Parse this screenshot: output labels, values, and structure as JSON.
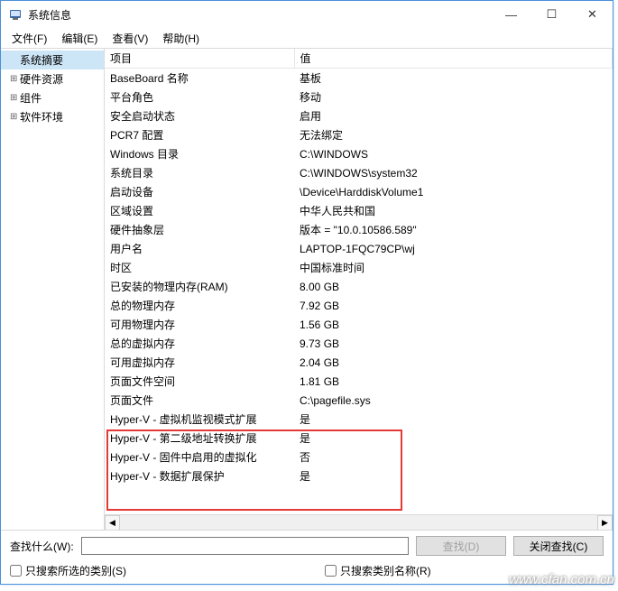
{
  "window": {
    "title": "系统信息"
  },
  "menubar": [
    {
      "label": "文件(F)"
    },
    {
      "label": "编辑(E)"
    },
    {
      "label": "查看(V)"
    },
    {
      "label": "帮助(H)"
    }
  ],
  "tree": [
    {
      "label": "系统摘要",
      "selected": true,
      "expand": ""
    },
    {
      "label": "硬件资源",
      "expand": "⊞"
    },
    {
      "label": "组件",
      "expand": "⊞"
    },
    {
      "label": "软件环境",
      "expand": "⊞"
    }
  ],
  "grid": {
    "headers": [
      "项目",
      "值"
    ],
    "rows": [
      [
        "BaseBoard 名称",
        "基板"
      ],
      [
        "平台角色",
        "移动"
      ],
      [
        "安全启动状态",
        "启用"
      ],
      [
        "PCR7 配置",
        "无法绑定"
      ],
      [
        "Windows 目录",
        "C:\\WINDOWS"
      ],
      [
        "系统目录",
        "C:\\WINDOWS\\system32"
      ],
      [
        "启动设备",
        "\\Device\\HarddiskVolume1"
      ],
      [
        "区域设置",
        "中华人民共和国"
      ],
      [
        "硬件抽象层",
        "版本 = \"10.0.10586.589\""
      ],
      [
        "用户名",
        "LAPTOP-1FQC79CP\\wj"
      ],
      [
        "时区",
        "中国标准时间"
      ],
      [
        "已安装的物理内存(RAM)",
        "8.00 GB"
      ],
      [
        "总的物理内存",
        "7.92 GB"
      ],
      [
        "可用物理内存",
        "1.56 GB"
      ],
      [
        "总的虚拟内存",
        "9.73 GB"
      ],
      [
        "可用虚拟内存",
        "2.04 GB"
      ],
      [
        "页面文件空间",
        "1.81 GB"
      ],
      [
        "页面文件",
        "C:\\pagefile.sys"
      ],
      [
        "Hyper-V - 虚拟机监视模式扩展",
        "是"
      ],
      [
        "Hyper-V - 第二级地址转换扩展",
        "是"
      ],
      [
        "Hyper-V - 固件中启用的虚拟化",
        "否"
      ],
      [
        "Hyper-V - 数据扩展保护",
        "是"
      ]
    ]
  },
  "find": {
    "label": "查找什么(W):",
    "value": "",
    "findButton": "查找(D)",
    "closeButton": "关闭查找(C)"
  },
  "options": {
    "selectedCategoryOnly": "只搜索所选的类别(S)",
    "categoryNamesOnly": "只搜索类别名称(R)"
  },
  "watermark": "www.cfan.com.cn"
}
